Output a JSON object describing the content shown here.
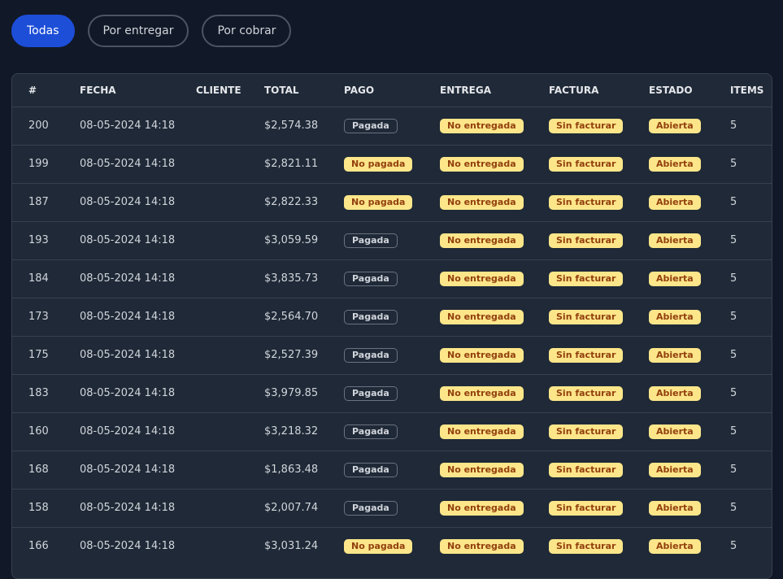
{
  "filters": [
    {
      "label": "Todas",
      "active": true
    },
    {
      "label": "Por entregar",
      "active": false
    },
    {
      "label": "Por cobrar",
      "active": false
    }
  ],
  "columns": {
    "num": "#",
    "fecha": "FECHA",
    "cliente": "CLIENTE",
    "total": "TOTAL",
    "pago": "PAGO",
    "entrega": "ENTREGA",
    "factura": "FACTURA",
    "estado": "ESTADO",
    "items": "ITEMS"
  },
  "colors": {
    "accent": "#1d4ed8",
    "badge_yellow_bg": "#fde68a",
    "badge_yellow_text": "#92400e"
  },
  "rows": [
    {
      "num": "200",
      "fecha": "08-05-2024 14:18",
      "cliente": "",
      "total": "$2,574.38",
      "pago": "Pagada",
      "entrega": "No entregada",
      "factura": "Sin facturar",
      "estado": "Abierta",
      "items": "5"
    },
    {
      "num": "199",
      "fecha": "08-05-2024 14:18",
      "cliente": "",
      "total": "$2,821.11",
      "pago": "No pagada",
      "entrega": "No entregada",
      "factura": "Sin facturar",
      "estado": "Abierta",
      "items": "5"
    },
    {
      "num": "187",
      "fecha": "08-05-2024 14:18",
      "cliente": "",
      "total": "$2,822.33",
      "pago": "No pagada",
      "entrega": "No entregada",
      "factura": "Sin facturar",
      "estado": "Abierta",
      "items": "5"
    },
    {
      "num": "193",
      "fecha": "08-05-2024 14:18",
      "cliente": "",
      "total": "$3,059.59",
      "pago": "Pagada",
      "entrega": "No entregada",
      "factura": "Sin facturar",
      "estado": "Abierta",
      "items": "5"
    },
    {
      "num": "184",
      "fecha": "08-05-2024 14:18",
      "cliente": "",
      "total": "$3,835.73",
      "pago": "Pagada",
      "entrega": "No entregada",
      "factura": "Sin facturar",
      "estado": "Abierta",
      "items": "5"
    },
    {
      "num": "173",
      "fecha": "08-05-2024 14:18",
      "cliente": "",
      "total": "$2,564.70",
      "pago": "Pagada",
      "entrega": "No entregada",
      "factura": "Sin facturar",
      "estado": "Abierta",
      "items": "5"
    },
    {
      "num": "175",
      "fecha": "08-05-2024 14:18",
      "cliente": "",
      "total": "$2,527.39",
      "pago": "Pagada",
      "entrega": "No entregada",
      "factura": "Sin facturar",
      "estado": "Abierta",
      "items": "5"
    },
    {
      "num": "183",
      "fecha": "08-05-2024 14:18",
      "cliente": "",
      "total": "$3,979.85",
      "pago": "Pagada",
      "entrega": "No entregada",
      "factura": "Sin facturar",
      "estado": "Abierta",
      "items": "5"
    },
    {
      "num": "160",
      "fecha": "08-05-2024 14:18",
      "cliente": "",
      "total": "$3,218.32",
      "pago": "Pagada",
      "entrega": "No entregada",
      "factura": "Sin facturar",
      "estado": "Abierta",
      "items": "5"
    },
    {
      "num": "168",
      "fecha": "08-05-2024 14:18",
      "cliente": "",
      "total": "$1,863.48",
      "pago": "Pagada",
      "entrega": "No entregada",
      "factura": "Sin facturar",
      "estado": "Abierta",
      "items": "5"
    },
    {
      "num": "158",
      "fecha": "08-05-2024 14:18",
      "cliente": "",
      "total": "$2,007.74",
      "pago": "Pagada",
      "entrega": "No entregada",
      "factura": "Sin facturar",
      "estado": "Abierta",
      "items": "5"
    },
    {
      "num": "166",
      "fecha": "08-05-2024 14:18",
      "cliente": "",
      "total": "$3,031.24",
      "pago": "No pagada",
      "entrega": "No entregada",
      "factura": "Sin facturar",
      "estado": "Abierta",
      "items": "5"
    }
  ]
}
